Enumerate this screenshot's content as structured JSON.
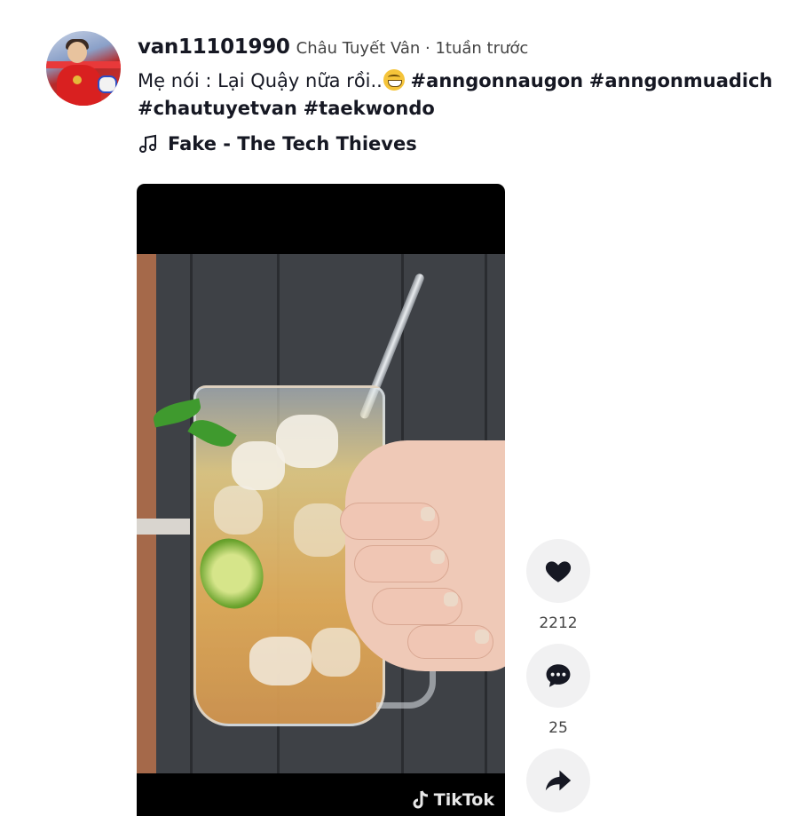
{
  "post": {
    "username": "van11101990",
    "nickname_meta": "Châu Tuyết Vân · 1tuần trước",
    "description_text": "Mẹ nói : Lại Quậy nữa rồi..",
    "emoji_icon": "grinning-face-icon",
    "hashtags": [
      "#anngonnaugon",
      "#anngonmuadich",
      "#chautuyetvan",
      "#taekwondo"
    ],
    "music_title": "Fake - The Tech Thieves"
  },
  "video": {
    "watermark": "TikTok"
  },
  "actions": {
    "likes": "2212",
    "comments": "25"
  },
  "colors": {
    "text": "#161823",
    "button_bg": "#f1f1f2"
  }
}
